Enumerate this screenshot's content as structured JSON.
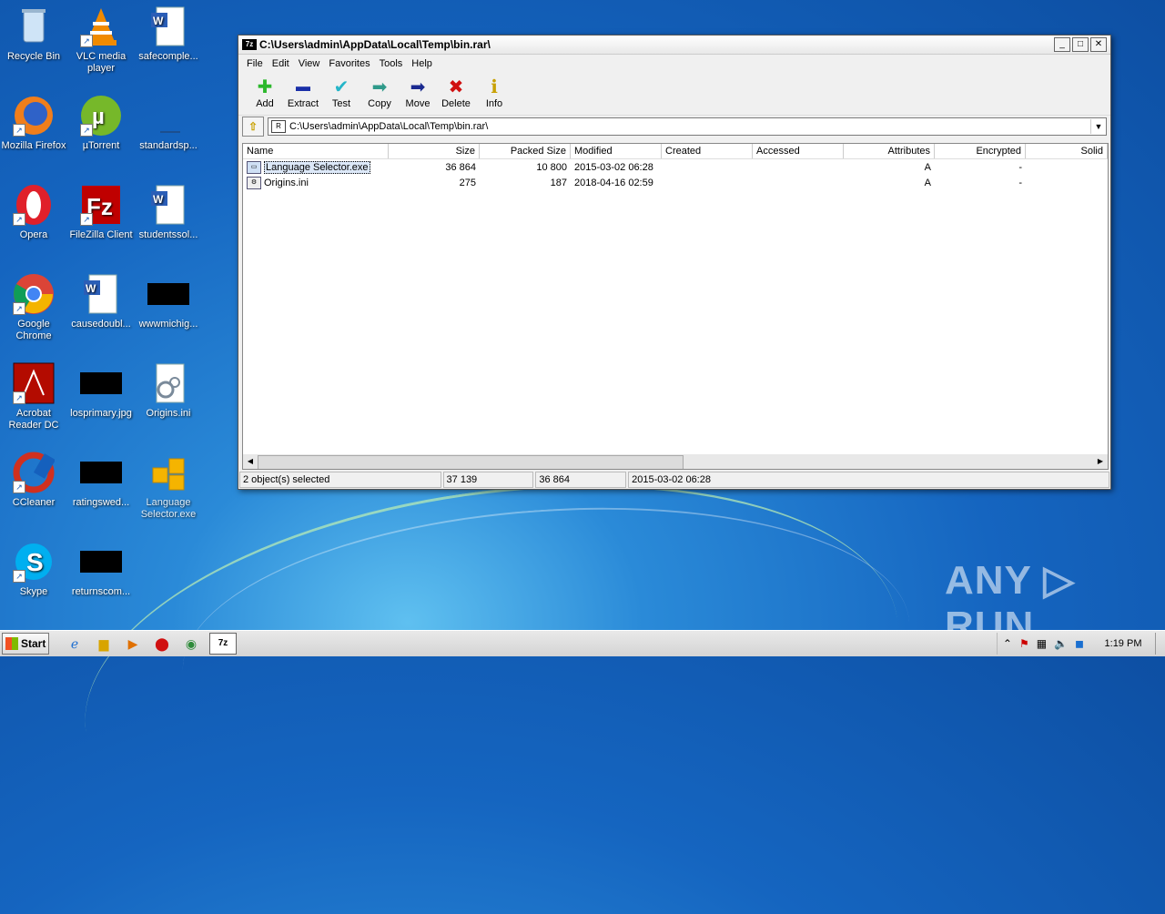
{
  "desktop": {
    "icons": [
      {
        "label": "Recycle Bin"
      },
      {
        "label": "VLC media player"
      },
      {
        "label": "safecomple..."
      },
      {
        "label": "Mozilla Firefox"
      },
      {
        "label": "µTorrent"
      },
      {
        "label": "standardsp..."
      },
      {
        "label": "Opera"
      },
      {
        "label": "FileZilla Client"
      },
      {
        "label": "studentssol..."
      },
      {
        "label": "Google Chrome"
      },
      {
        "label": "causedoubl..."
      },
      {
        "label": "wwwmichig..."
      },
      {
        "label": "Acrobat Reader DC"
      },
      {
        "label": "losprimary.jpg"
      },
      {
        "label": "Origins.ini"
      },
      {
        "label": "CCleaner"
      },
      {
        "label": "ratingswed..."
      },
      {
        "label": "Language Selector.exe"
      },
      {
        "label": "Skype"
      },
      {
        "label": "returnscom..."
      }
    ]
  },
  "window": {
    "title": "C:\\Users\\admin\\AppData\\Local\\Temp\\bin.rar\\",
    "app_icon": "7z",
    "menu": [
      "File",
      "Edit",
      "View",
      "Favorites",
      "Tools",
      "Help"
    ],
    "toolbar": [
      {
        "label": "Add",
        "icon": "plus-icon",
        "color": "#2db82d",
        "glyph": "✚"
      },
      {
        "label": "Extract",
        "icon": "minus-icon",
        "color": "#1a2fa8",
        "glyph": "▬"
      },
      {
        "label": "Test",
        "icon": "check-icon",
        "color": "#25b5c8",
        "glyph": "✔"
      },
      {
        "label": "Copy",
        "icon": "copy-arrow-icon",
        "color": "#2f9a8a",
        "glyph": "➡"
      },
      {
        "label": "Move",
        "icon": "move-arrow-icon",
        "color": "#1a2a90",
        "glyph": "➡"
      },
      {
        "label": "Delete",
        "icon": "delete-x-icon",
        "color": "#d01010",
        "glyph": "✖"
      },
      {
        "label": "Info",
        "icon": "info-icon",
        "color": "#c8a000",
        "glyph": "ℹ"
      }
    ],
    "address": "C:\\Users\\admin\\AppData\\Local\\Temp\\bin.rar\\",
    "columns": [
      "Name",
      "Size",
      "Packed Size",
      "Modified",
      "Created",
      "Accessed",
      "Attributes",
      "Encrypted",
      "Solid"
    ],
    "files": [
      {
        "name": "Language Selector.exe",
        "size": "36 864",
        "packed": "10 800",
        "modified": "2015-03-02 06:28",
        "created": "",
        "accessed": "",
        "attributes": "A",
        "encrypted": "-",
        "selected": true
      },
      {
        "name": "Origins.ini",
        "size": "275",
        "packed": "187",
        "modified": "2018-04-16 02:59",
        "created": "",
        "accessed": "",
        "attributes": "A",
        "encrypted": "-",
        "selected": false
      }
    ],
    "status": {
      "selection": "2 object(s) selected",
      "total": "37 139",
      "size": "36 864",
      "modified": "2015-03-02 06:28"
    }
  },
  "taskbar": {
    "start_label": "Start",
    "clock": "1:19 PM"
  },
  "watermark": "ANY ▷ RUN"
}
